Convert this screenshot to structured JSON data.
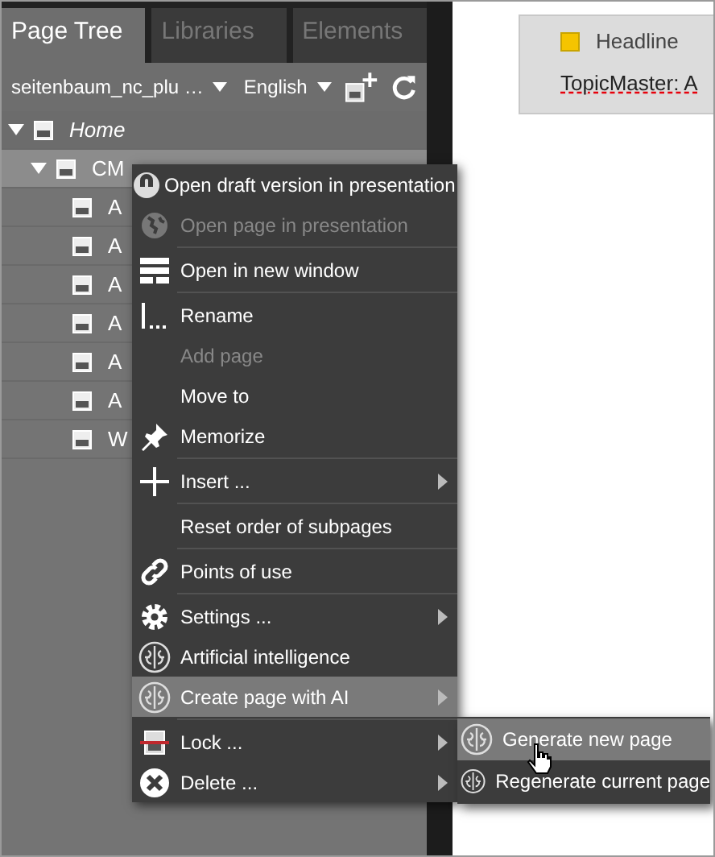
{
  "tabs": [
    {
      "label": "Page Tree",
      "selected": true
    },
    {
      "label": "Libraries",
      "selected": false
    },
    {
      "label": "Elements",
      "selected": false
    }
  ],
  "toolbar": {
    "site": "seitenbaum_nc_plu …",
    "language": "English"
  },
  "tree": [
    {
      "label": "Home",
      "expanded": true,
      "selected": false,
      "children": [
        {
          "label": "CM",
          "expanded": true,
          "selected": true,
          "children": [
            {
              "label": "A"
            },
            {
              "label": "A"
            },
            {
              "label": "A"
            },
            {
              "label": "A"
            },
            {
              "label": "A"
            },
            {
              "label": "A"
            },
            {
              "label": "W"
            }
          ]
        }
      ]
    }
  ],
  "preview": {
    "headline": "Headline",
    "text": "TopicMaster: A"
  },
  "context_menu": [
    {
      "label": "Open draft version in presentation",
      "kind": "draft",
      "disabled": false,
      "submenu": false,
      "selected": false,
      "divider_after": false
    },
    {
      "label": "Open page in presentation",
      "kind": "globe",
      "disabled": true,
      "submenu": false,
      "selected": false,
      "divider_after": true
    },
    {
      "label": "Open in new window",
      "kind": "window",
      "disabled": false,
      "submenu": false,
      "selected": false,
      "divider_after": true
    },
    {
      "label": "Rename",
      "kind": "rename",
      "disabled": false,
      "submenu": false,
      "selected": false,
      "divider_after": false
    },
    {
      "label": "Add page",
      "kind": "none",
      "disabled": true,
      "submenu": false,
      "selected": false,
      "divider_after": false
    },
    {
      "label": "Move to",
      "kind": "none",
      "disabled": false,
      "submenu": false,
      "selected": false,
      "divider_after": false
    },
    {
      "label": "Memorize",
      "kind": "pin",
      "disabled": false,
      "submenu": false,
      "selected": false,
      "divider_after": true
    },
    {
      "label": "Insert ...",
      "kind": "plus",
      "disabled": false,
      "submenu": true,
      "selected": false,
      "divider_after": true
    },
    {
      "label": "Reset order of subpages",
      "kind": "none",
      "disabled": false,
      "submenu": false,
      "selected": false,
      "divider_after": true
    },
    {
      "label": "Points of use",
      "kind": "link",
      "disabled": false,
      "submenu": false,
      "selected": false,
      "divider_after": true
    },
    {
      "label": "Settings ...",
      "kind": "gear",
      "disabled": false,
      "submenu": true,
      "selected": false,
      "divider_after": false
    },
    {
      "label": "Artificial intelligence",
      "kind": "brain",
      "disabled": false,
      "submenu": false,
      "selected": false,
      "divider_after": false
    },
    {
      "label": "Create page with AI",
      "kind": "brain",
      "disabled": false,
      "submenu": true,
      "selected": true,
      "divider_after": true
    },
    {
      "label": "Lock ...",
      "kind": "lock",
      "disabled": false,
      "submenu": true,
      "selected": false,
      "divider_after": false
    },
    {
      "label": "Delete ...",
      "kind": "delete",
      "disabled": false,
      "submenu": true,
      "selected": false,
      "divider_after": false
    }
  ],
  "submenu": [
    {
      "label": "Generate new page",
      "kind": "brain",
      "selected": true
    },
    {
      "label": "Regenerate current page",
      "kind": "brain",
      "selected": false
    }
  ]
}
